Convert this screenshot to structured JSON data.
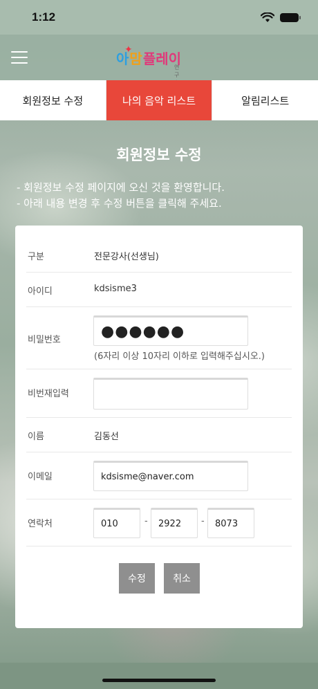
{
  "status": {
    "time": "1:12"
  },
  "header": {
    "logo": {
      "part1": "아",
      "part2": "맘",
      "part3": "플레이",
      "sub": "연구소"
    }
  },
  "tabs": [
    {
      "label": "회원정보 수정"
    },
    {
      "label": "나의 음악 리스트"
    },
    {
      "label": "알림리스트"
    }
  ],
  "page": {
    "title": "회원정보 수정",
    "intro": [
      "- 회원정보 수정 페이지에 오신 것을 환영합니다.",
      "- 아래 내용 변경 후 수정 버튼을 클릭해 주세요."
    ]
  },
  "form": {
    "category": {
      "label": "구분",
      "value": "전문강사(선생님)"
    },
    "user_id": {
      "label": "아이디",
      "value": "kdsisme3"
    },
    "password": {
      "label": "비밀번호",
      "value": "●●●●●●",
      "hint": "(6자리 이상 10자리 이하로 입력해주십시오.)"
    },
    "password_confirm": {
      "label": "비번재입력",
      "value": ""
    },
    "name": {
      "label": "이름",
      "value": "김동선"
    },
    "email": {
      "label": "이메일",
      "value": "kdsisme@naver.com"
    },
    "phone": {
      "label": "연락처",
      "part1": "010",
      "part2": "2922",
      "part3": "8073",
      "separator": "-"
    }
  },
  "buttons": {
    "submit": "수정",
    "cancel": "취소"
  },
  "colors": {
    "active_tab": "#e8473a",
    "button": "#8f8f8f"
  }
}
